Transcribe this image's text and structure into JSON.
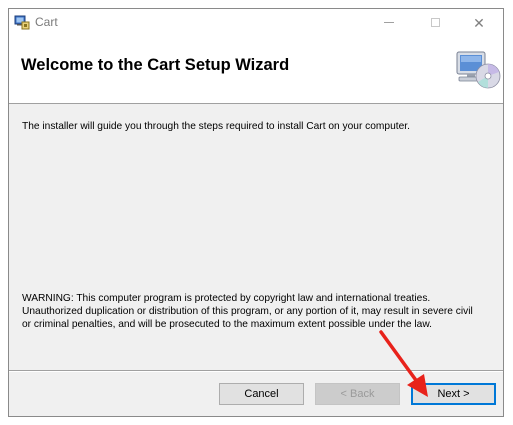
{
  "window": {
    "title": "Cart"
  },
  "banner": {
    "title": "Welcome to the Cart Setup Wizard"
  },
  "content": {
    "intro": "The installer will guide you through the steps required to install Cart on your computer.",
    "warning_lines": [
      "WARNING: This computer program is protected by copyright law and international treaties.",
      "Unauthorized duplication or distribution of this program, or any portion of it, may result in severe civil",
      "or criminal penalties, and will be prosecuted to the maximum extent possible under the law."
    ]
  },
  "buttons": {
    "cancel": "Cancel",
    "back": "< Back",
    "next": "Next >"
  },
  "colors": {
    "accent": "#0078d7",
    "annotation_arrow": "#e8221b"
  }
}
